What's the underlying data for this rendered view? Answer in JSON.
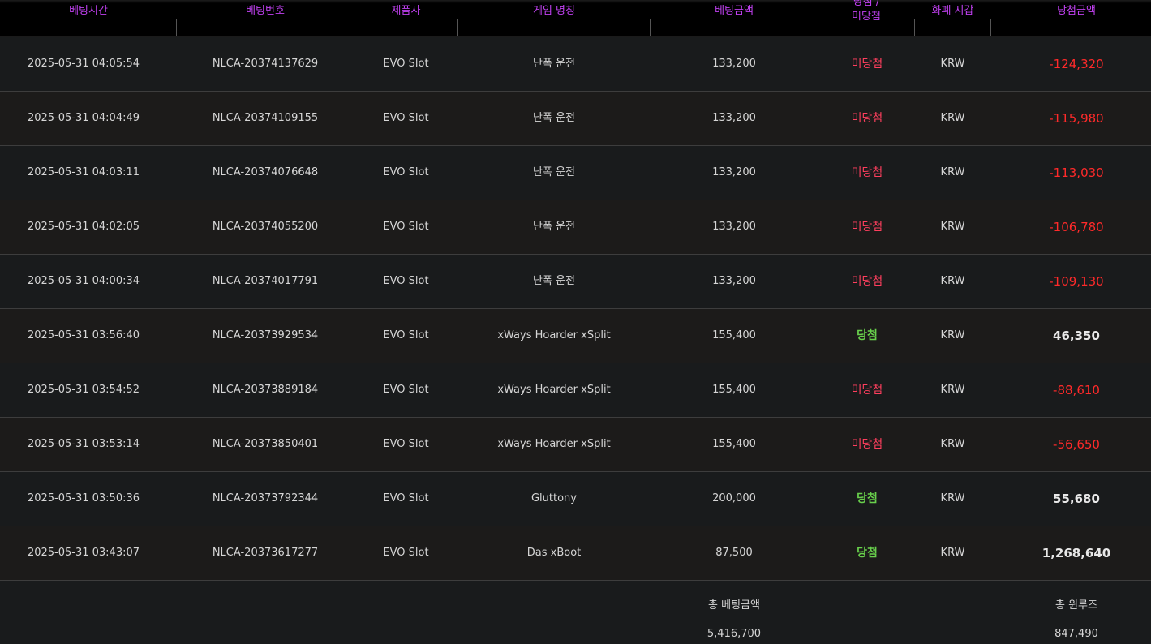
{
  "headers": {
    "bet_time": "베팅시간",
    "bet_number": "베팅번호",
    "provider": "제품사",
    "game_name": "게임 명칭",
    "bet_amount": "베팅금액",
    "result_line1": "당첨 /",
    "result_line2": "미당첨",
    "currency": "화폐 지갑",
    "win_amount": "당첨금액"
  },
  "rows": [
    {
      "time": "2025-05-31 04:05:54",
      "number": "NLCA-20374137629",
      "provider": "EVO Slot",
      "game": "난폭 운전",
      "bet": "133,200",
      "result": "미당첨",
      "win": false,
      "currency": "KRW",
      "amount": "-124,320"
    },
    {
      "time": "2025-05-31 04:04:49",
      "number": "NLCA-20374109155",
      "provider": "EVO Slot",
      "game": "난폭 운전",
      "bet": "133,200",
      "result": "미당첨",
      "win": false,
      "currency": "KRW",
      "amount": "-115,980"
    },
    {
      "time": "2025-05-31 04:03:11",
      "number": "NLCA-20374076648",
      "provider": "EVO Slot",
      "game": "난폭 운전",
      "bet": "133,200",
      "result": "미당첨",
      "win": false,
      "currency": "KRW",
      "amount": "-113,030"
    },
    {
      "time": "2025-05-31 04:02:05",
      "number": "NLCA-20374055200",
      "provider": "EVO Slot",
      "game": "난폭 운전",
      "bet": "133,200",
      "result": "미당첨",
      "win": false,
      "currency": "KRW",
      "amount": "-106,780"
    },
    {
      "time": "2025-05-31 04:00:34",
      "number": "NLCA-20374017791",
      "provider": "EVO Slot",
      "game": "난폭 운전",
      "bet": "133,200",
      "result": "미당첨",
      "win": false,
      "currency": "KRW",
      "amount": "-109,130"
    },
    {
      "time": "2025-05-31 03:56:40",
      "number": "NLCA-20373929534",
      "provider": "EVO Slot",
      "game": "xWays Hoarder xSplit",
      "bet": "155,400",
      "result": "당첨",
      "win": true,
      "currency": "KRW",
      "amount": "46,350"
    },
    {
      "time": "2025-05-31 03:54:52",
      "number": "NLCA-20373889184",
      "provider": "EVO Slot",
      "game": "xWays Hoarder xSplit",
      "bet": "155,400",
      "result": "미당첨",
      "win": false,
      "currency": "KRW",
      "amount": "-88,610"
    },
    {
      "time": "2025-05-31 03:53:14",
      "number": "NLCA-20373850401",
      "provider": "EVO Slot",
      "game": "xWays Hoarder xSplit",
      "bet": "155,400",
      "result": "미당첨",
      "win": false,
      "currency": "KRW",
      "amount": "-56,650"
    },
    {
      "time": "2025-05-31 03:50:36",
      "number": "NLCA-20373792344",
      "provider": "EVO Slot",
      "game": "Gluttony",
      "bet": "200,000",
      "result": "당첨",
      "win": true,
      "currency": "KRW",
      "amount": "55,680"
    },
    {
      "time": "2025-05-31 03:43:07",
      "number": "NLCA-20373617277",
      "provider": "EVO Slot",
      "game": "Das xBoot",
      "bet": "87,500",
      "result": "당첨",
      "win": true,
      "currency": "KRW",
      "amount": "1,268,640"
    }
  ],
  "summary": {
    "total_bet_label": "총 베팅금액",
    "total_bet_value": "5,416,700",
    "total_winloss_label": "총 윈루즈",
    "total_winloss_value": "847,490"
  },
  "colors": {
    "header_text": "#c040f0",
    "lose": "#ff3f5e",
    "win": "#68d04c",
    "negative_amount": "#ff2a2a"
  }
}
